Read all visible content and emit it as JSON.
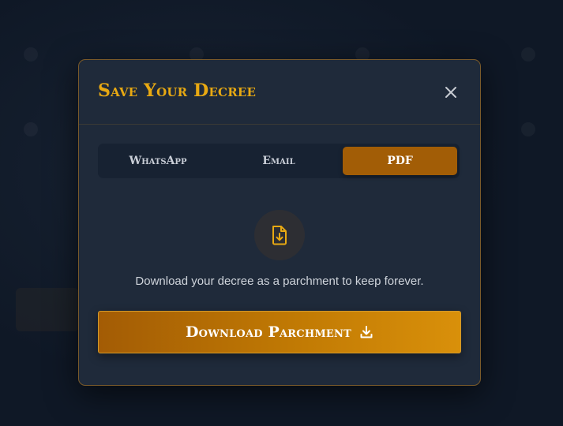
{
  "modal": {
    "title": "Save Your Decree",
    "close_label": "Close",
    "tabs": [
      {
        "label": "WhatsApp",
        "active": false
      },
      {
        "label": "Email",
        "active": false
      },
      {
        "label": "PDF",
        "active": true
      }
    ],
    "pdf_panel": {
      "icon": "file-download-icon",
      "description": "Download your decree as a parchment to keep forever.",
      "button_label": "Download Parchment",
      "button_icon": "download-icon"
    }
  },
  "colors": {
    "accent": "#e8a912",
    "active_tab": "#a25d06",
    "modal_bg": "#1f2a3a",
    "backdrop": "#0f1826"
  }
}
